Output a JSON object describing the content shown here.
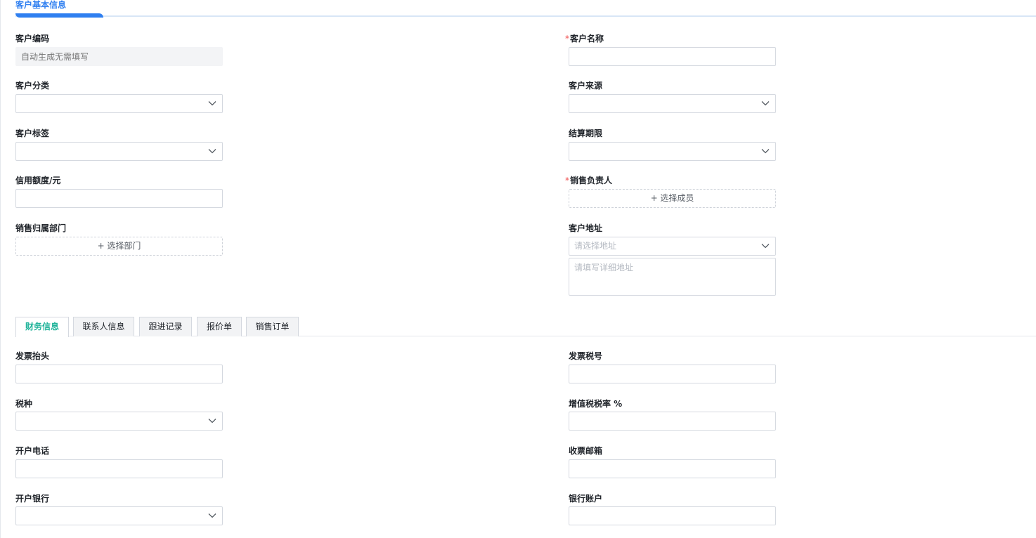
{
  "section": {
    "title": "客户基本信息"
  },
  "basic": {
    "code": {
      "label": "客户编码",
      "placeholder": "自动生成无需填写"
    },
    "name": {
      "label": "客户名称",
      "required_mark": "*"
    },
    "category": {
      "label": "客户分类"
    },
    "source": {
      "label": "客户来源"
    },
    "tag": {
      "label": "客户标签"
    },
    "settlement": {
      "label": "结算期限"
    },
    "credit": {
      "label": "信用额度/元"
    },
    "sales_owner": {
      "label": "销售负责人",
      "required_mark": "*",
      "button": "+ 选择成员"
    },
    "sales_dept": {
      "label": "销售归属部门",
      "button": "+ 选择部门"
    },
    "address": {
      "label": "客户地址",
      "select_placeholder": "请选择地址",
      "detail_placeholder": "请填写详细地址"
    }
  },
  "tabs": [
    {
      "label": "财务信息",
      "active": true
    },
    {
      "label": "联系人信息"
    },
    {
      "label": "跟进记录"
    },
    {
      "label": "报价单"
    },
    {
      "label": "销售订单"
    }
  ],
  "finance": {
    "invoice_title": {
      "label": "发票抬头"
    },
    "tax_no": {
      "label": "发票税号"
    },
    "tax_type": {
      "label": "税种"
    },
    "vat_rate": {
      "label": "增值税税率 %"
    },
    "phone": {
      "label": "开户电话"
    },
    "email": {
      "label": "收票邮箱"
    },
    "bank": {
      "label": "开户银行"
    },
    "account": {
      "label": "银行账户"
    }
  },
  "colors": {
    "accent": "#2f7ff0",
    "active_tab": "#20b39a",
    "required": "#f05050"
  },
  "icons": {
    "select_arrow": "chevron-down-icon"
  }
}
